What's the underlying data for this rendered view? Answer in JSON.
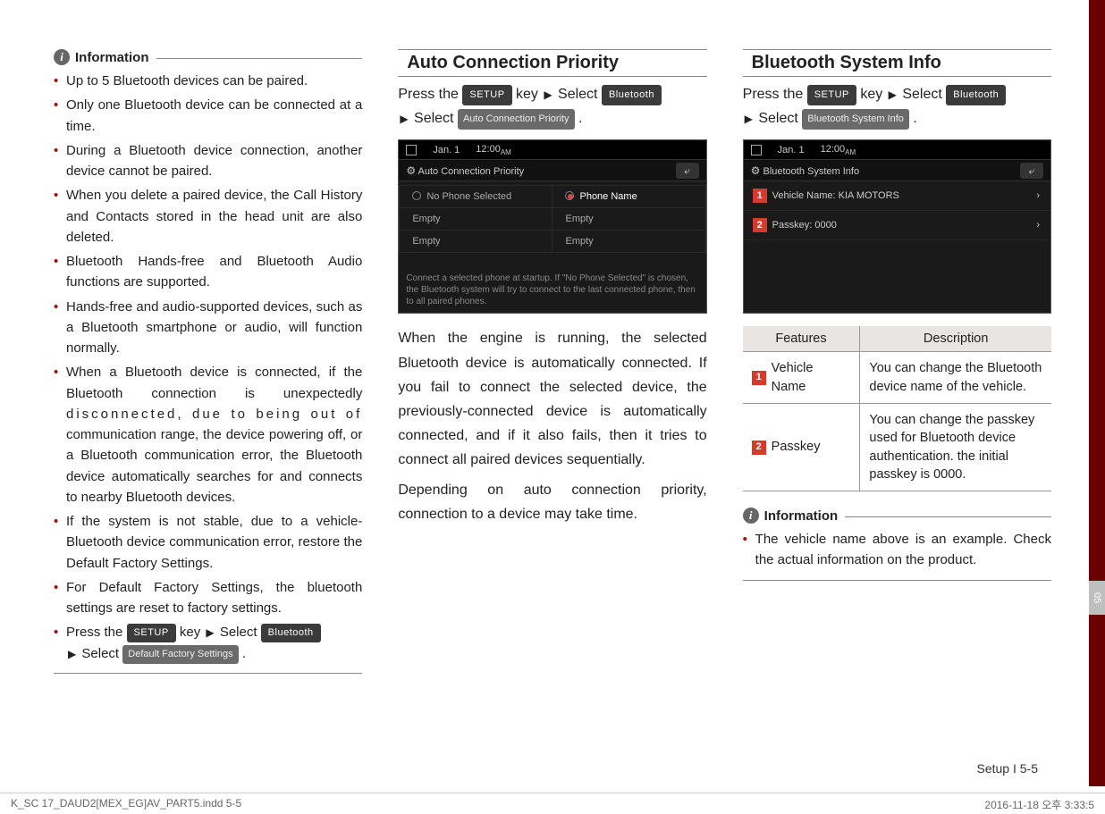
{
  "col1": {
    "info_label": "Information",
    "bullets": [
      "Up to 5 Bluetooth devices can be paired.",
      "Only one Bluetooth device can be connected at a time.",
      "During a Bluetooth device connection, another device cannot be paired.",
      "When you delete a paired device, the Call History and Contacts stored in the head unit are also deleted.",
      "Bluetooth Hands-free and Bluetooth Audio functions are supported.",
      "Hands-free and audio-supported devices, such as a Bluetooth smartphone or audio, will function normally.",
      "When a Bluetooth device is connected, if the Bluetooth connection is unexpectedly disconnected, due to being out of communication range, the device powering off, or a Bluetooth communication error, the Bluetooth device automatically searches for and connects to nearby Bluetooth devices.",
      "If the system is not stable, due to a vehicle-Bluetooth device communication error, restore the Default Factory Settings.",
      "For Default Factory Settings, the bluetooth settings are reset to factory settings."
    ],
    "last_bullet": {
      "prefix": "Press the ",
      "setup": "SETUP",
      "mid1": " key ",
      "select1": " Select ",
      "bluetooth": "Bluetooth",
      "select2": " Select ",
      "dfs": "Default Factory Settings",
      "suffix": "."
    }
  },
  "col2": {
    "title": "Auto Connection Priority",
    "instr": {
      "prefix": "Press the ",
      "setup": "SETUP",
      "mid1": " key ",
      "select1": " Select ",
      "bluetooth": "Bluetooth",
      "select2": " Select ",
      "menu": "Auto Connection Priority",
      "suffix": "."
    },
    "screen": {
      "date": "Jan. 1",
      "time": "12:00",
      "ampm": "AM",
      "title": "Auto Connection Priority",
      "opt1": "No Phone Selected",
      "opt2": "Phone Name",
      "empty": "Empty",
      "hint": "Connect a selected phone at startup. If \"No Phone Selected\" is chosen, the Bluetooth system will try to connect to the last connected phone, then to all paired phones."
    },
    "para1": "When the engine is running, the selected Bluetooth device is automatically connected. If you fail to connect the selected device, the previously-connected device is automatically connected, and if it also fails, then it tries to connect all paired devices sequentially.",
    "para2": "Depending on auto connection priority, connection to a device may take time."
  },
  "col3": {
    "title": "Bluetooth System Info",
    "instr": {
      "prefix": "Press the ",
      "setup": "SETUP",
      "mid1": " key ",
      "select1": " Select ",
      "bluetooth": "Bluetooth",
      "select2": " Select ",
      "menu": "Bluetooth System Info",
      "suffix": "."
    },
    "screen": {
      "date": "Jan. 1",
      "time": "12:00",
      "ampm": "AM",
      "title": "Bluetooth System Info",
      "row1": "Vehicle Name: KIA MOTORS",
      "row2": "Passkey: 0000"
    },
    "table": {
      "h1": "Features",
      "h2": "Description",
      "r1f": "Vehicle Name",
      "r1d": "You can change the Bluetooth device name of the vehicle.",
      "r2f": "Passkey",
      "r2d": "You can change the passkey used for Bluetooth device authentication. the initial passkey is 0000."
    },
    "info_label": "Information",
    "info_bullet": "The vehicle name above is an example. Check the actual information on the product."
  },
  "footer": {
    "page": "Setup I 5-5",
    "file": "K_SC 17_DAUD2[MEX_EG]AV_PART5.indd   5-5",
    "ts": "2016-11-18   오후 3:33:5",
    "tab": "05"
  }
}
